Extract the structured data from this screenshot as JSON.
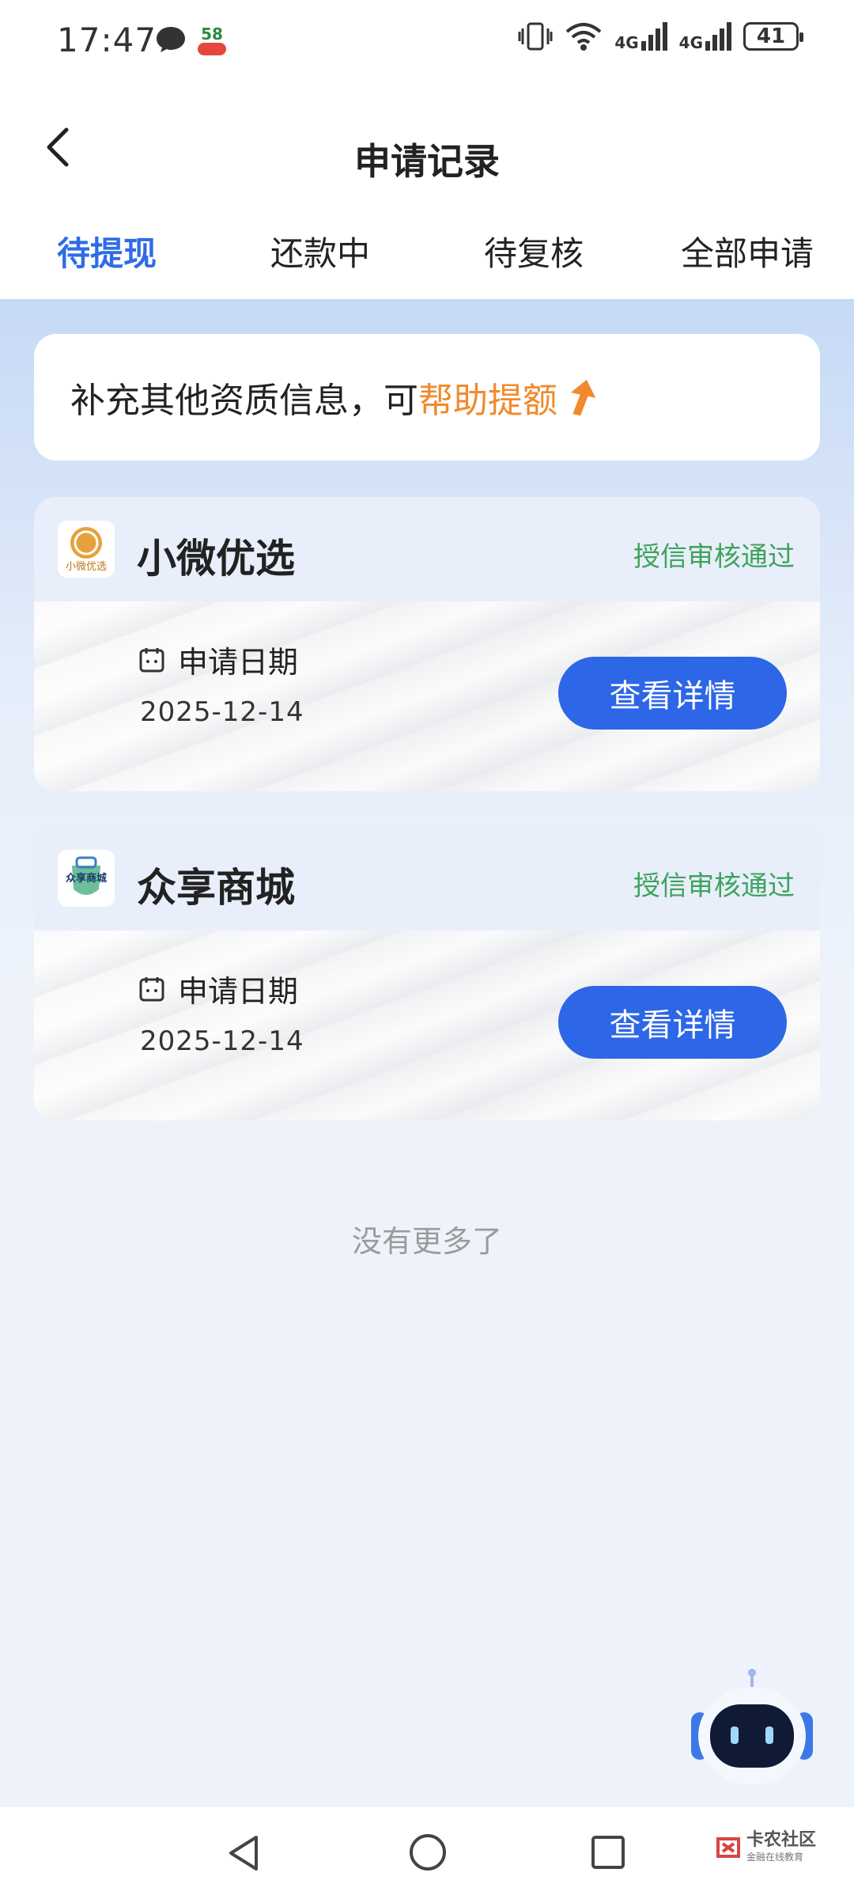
{
  "status_bar": {
    "time": "17:47",
    "app_badge": "58",
    "network1": "4G",
    "network2": "4G",
    "battery": "41"
  },
  "header": {
    "title": "申请记录"
  },
  "tabs": [
    {
      "label": "待提现",
      "active": true
    },
    {
      "label": "还款中",
      "active": false
    },
    {
      "label": "待复核",
      "active": false
    },
    {
      "label": "全部申请",
      "active": false
    }
  ],
  "banner": {
    "text": "补充其他资质信息，可",
    "highlight": "帮助提额"
  },
  "cards": [
    {
      "name": "小微优选",
      "logo_text": "小微优选",
      "status": "授信审核通过",
      "date_label": "申请日期",
      "date": "2025-12-14",
      "button": "查看详情"
    },
    {
      "name": "众享商城",
      "logo_text": "众享商城",
      "status": "授信审核通过",
      "date_label": "申请日期",
      "date": "2025-12-14",
      "button": "查看详情"
    }
  ],
  "footer_text": "没有更多了",
  "watermark": {
    "title": "卡农社区",
    "subtitle": "金融在线教育"
  },
  "colors": {
    "accent": "#2f6ce5",
    "highlight": "#f08a2c",
    "status_green": "#3ea35c"
  }
}
